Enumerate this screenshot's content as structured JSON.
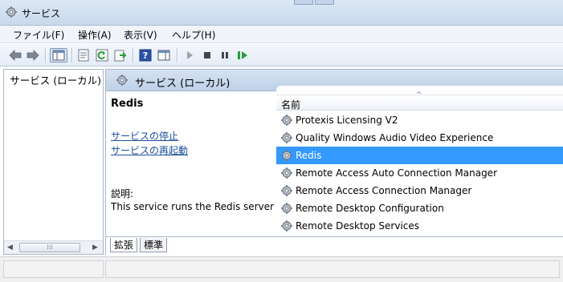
{
  "window": {
    "title": "サービス",
    "icon": "services-gear-icon"
  },
  "menu": [
    "ファイル(F)",
    "操作(A)",
    "表示(V)",
    "ヘルプ(H)"
  ],
  "toolbar": {
    "buttons": [
      "back-icon",
      "forward-icon",
      "show-hide-tree-icon",
      "properties-icon",
      "refresh-icon",
      "export-list-icon",
      "help-icon",
      "show-hide-action-pane-icon",
      "start-service-icon",
      "stop-service-icon",
      "pause-service-icon",
      "restart-service-icon"
    ]
  },
  "tree": {
    "root_label": "サービス (ローカル)"
  },
  "content": {
    "header_title": "サービス (ローカル)",
    "selected_service": "Redis",
    "actions": [
      "サービスの停止",
      "サービスの再起動"
    ],
    "description_label": "説明:",
    "description_text": "This service runs the Redis server"
  },
  "list": {
    "column_name": "名前",
    "sort_indicator": "ascending",
    "rows": [
      "Protexis Licensing V2",
      "Quality Windows Audio Video Experience",
      "Redis",
      "Remote Access Auto Connection Manager",
      "Remote Access Connection Manager",
      "Remote Desktop Configuration",
      "Remote Desktop Services"
    ],
    "selected_index": 2
  },
  "tabs": [
    "拡張",
    "標準"
  ],
  "colors": {
    "selection": "#3399ff",
    "link": "#1a4f9c",
    "header_band": "#c9d9ec"
  }
}
